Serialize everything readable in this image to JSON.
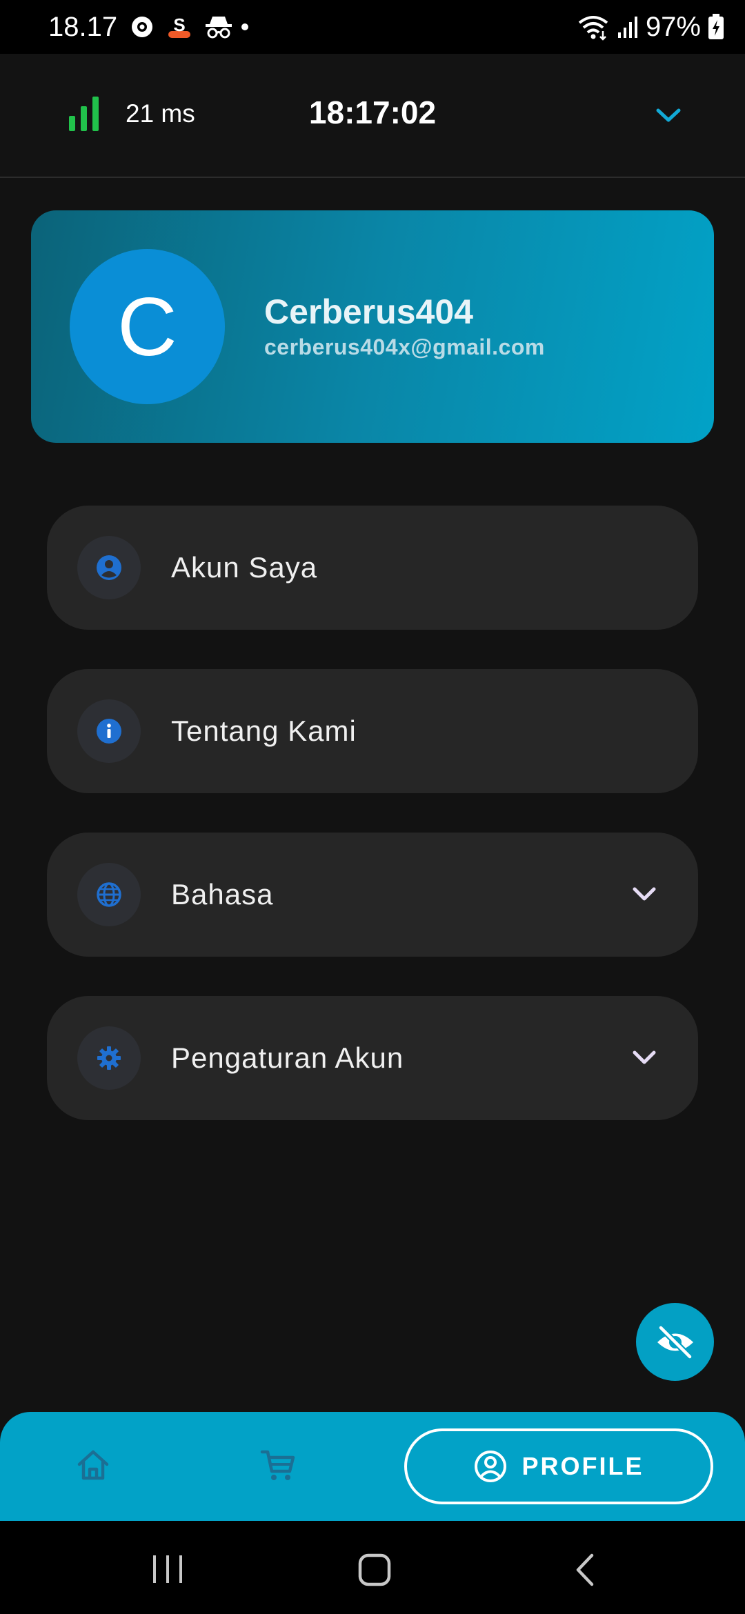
{
  "status_bar": {
    "time": "18.17",
    "battery": "97%",
    "icons": [
      "location-icon",
      "s-app-icon",
      "incognito-icon",
      "wifi-icon",
      "signal-icon",
      "battery-charging-icon"
    ]
  },
  "topbar": {
    "ping": "21 ms",
    "clock": "18:17:02",
    "signal_color": "#21c14b"
  },
  "profile": {
    "initial": "C",
    "name": "Cerberus404",
    "email": "cerberus404x@gmail.com"
  },
  "menu": [
    {
      "label": "Akun Saya",
      "icon": "account-circle-icon"
    },
    {
      "label": "Tentang Kami",
      "icon": "info-icon"
    },
    {
      "label": "Bahasa",
      "icon": "globe-icon"
    },
    {
      "label": "Pengaturan Akun",
      "icon": "gear-icon"
    }
  ],
  "bottom_nav": {
    "items": [
      {
        "name": "home",
        "icon": "home-icon"
      },
      {
        "name": "cart",
        "icon": "cart-icon"
      },
      {
        "name": "profile",
        "icon": "profile-icon"
      }
    ],
    "active_label": "PROFILE"
  },
  "colors": {
    "accent": "#02a2c7",
    "icon_blue": "#1f6fd0",
    "background": "#121212",
    "card": "#262626"
  }
}
